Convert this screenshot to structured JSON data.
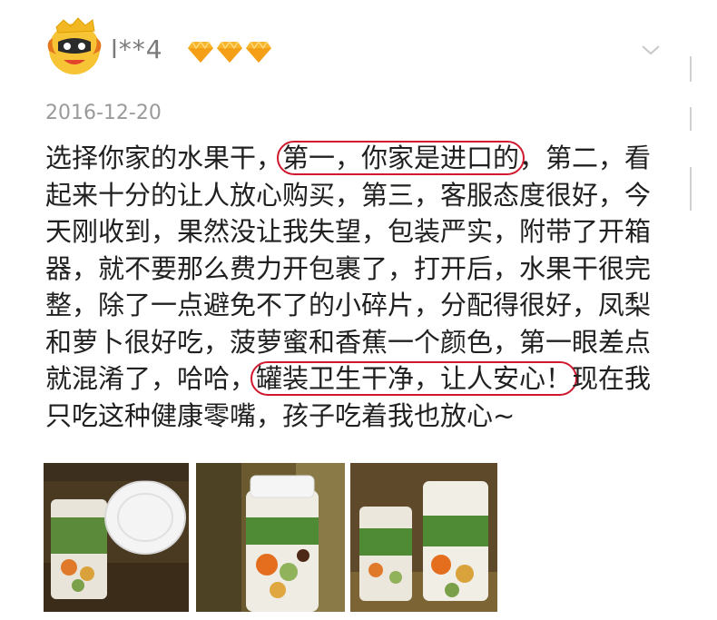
{
  "user": {
    "name": "l**4",
    "level_icons": [
      "diamond-icon",
      "diamond-icon",
      "diamond-icon"
    ]
  },
  "menu_icon": "chevron-down-icon",
  "date": "2016-12-20",
  "review": {
    "lines": [
      [
        "选择你家的水果干，",
        {
          "hl": "第一，你家是进口的"
        },
        "，第二，看"
      ],
      [
        "起来十分的让人放心购买，第三，客服态度很好，今"
      ],
      [
        "天刚收到，果然没让我失望，包装严实，附带了开箱"
      ],
      [
        "器，就不要那么费力开包裹了，打开后，水果干很完"
      ],
      [
        "整，除了一点避免不了的小碎片，分配得很好，凤梨"
      ],
      [
        "和萝卜很好吃，菠萝蜜和香蕉一个颜色，第一眼差点"
      ],
      [
        "就混淆了，哈哈，",
        {
          "hl": "罐装卫生干净，让人安心！"
        },
        "现在我"
      ],
      [
        "只吃这种健康零嘴，孩子吃着我也放心~"
      ]
    ]
  },
  "photos": [
    "photo-1",
    "photo-2",
    "photo-3"
  ],
  "colors": {
    "highlight_border": "#d0182e",
    "diamond": "#f5a623",
    "avatar_bg": "#f7c436"
  }
}
